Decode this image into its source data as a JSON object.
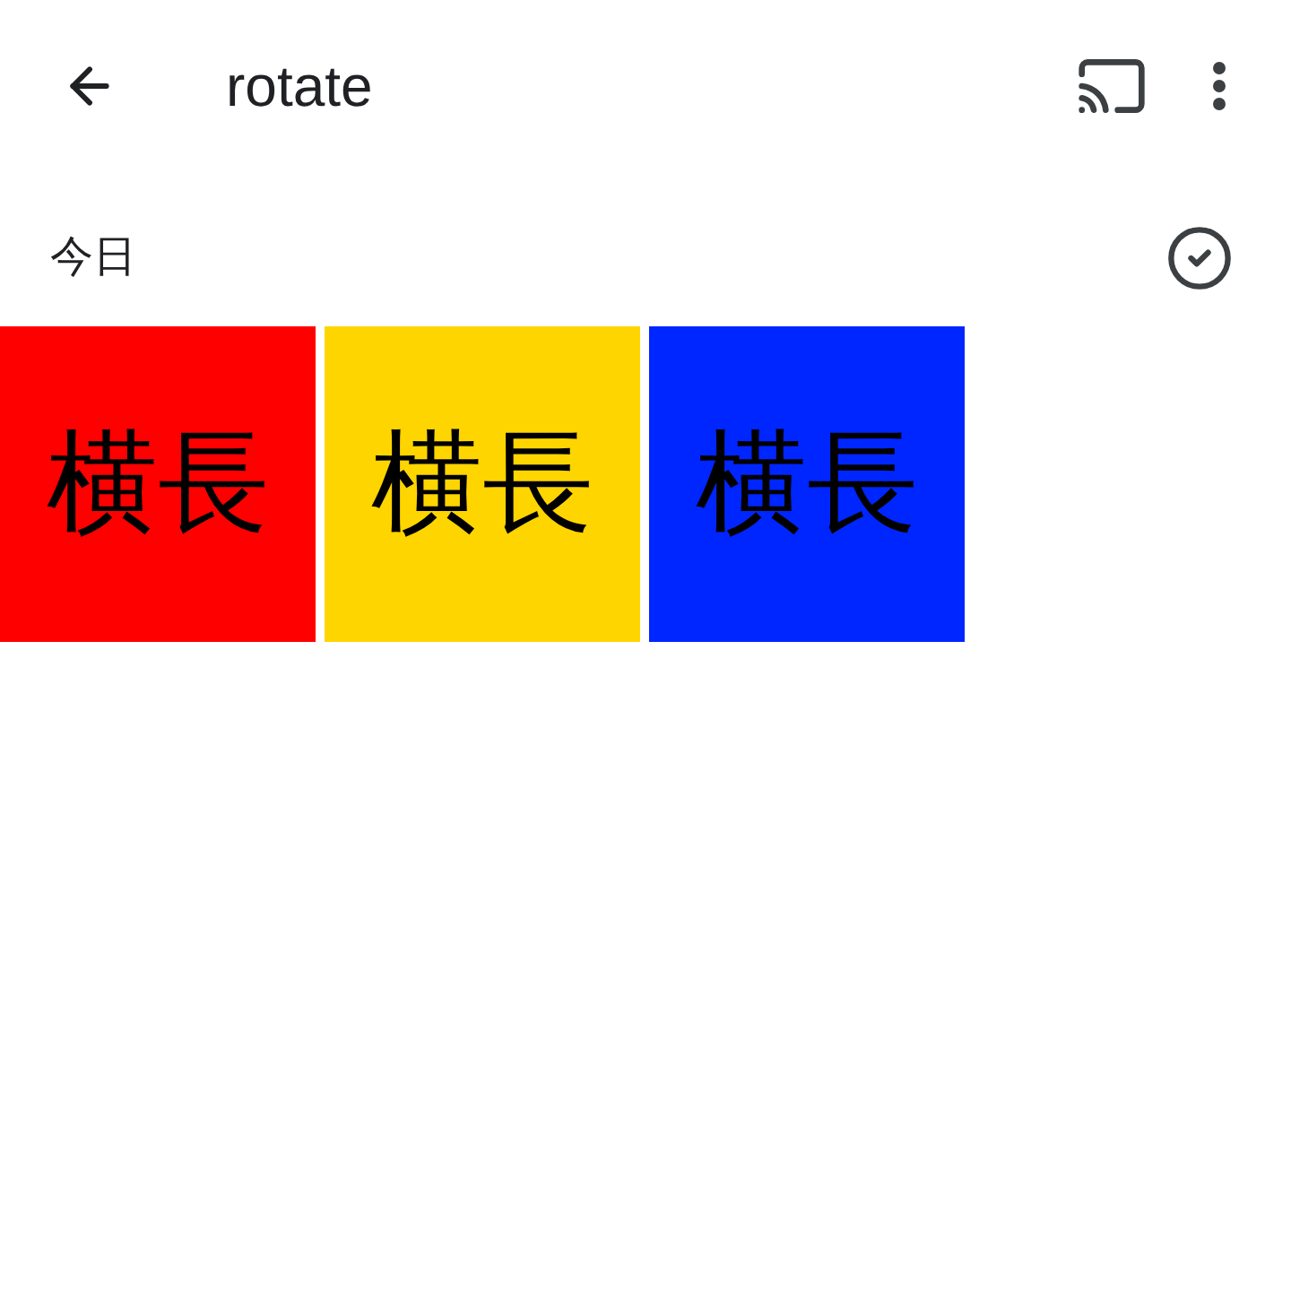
{
  "app_bar": {
    "title": "rotate"
  },
  "section": {
    "title": "今日",
    "thumbnails": [
      {
        "label": "横長",
        "color": "#ff0000"
      },
      {
        "label": "横長",
        "color": "#ffd500"
      },
      {
        "label": "横長",
        "color": "#0026ff"
      }
    ]
  }
}
